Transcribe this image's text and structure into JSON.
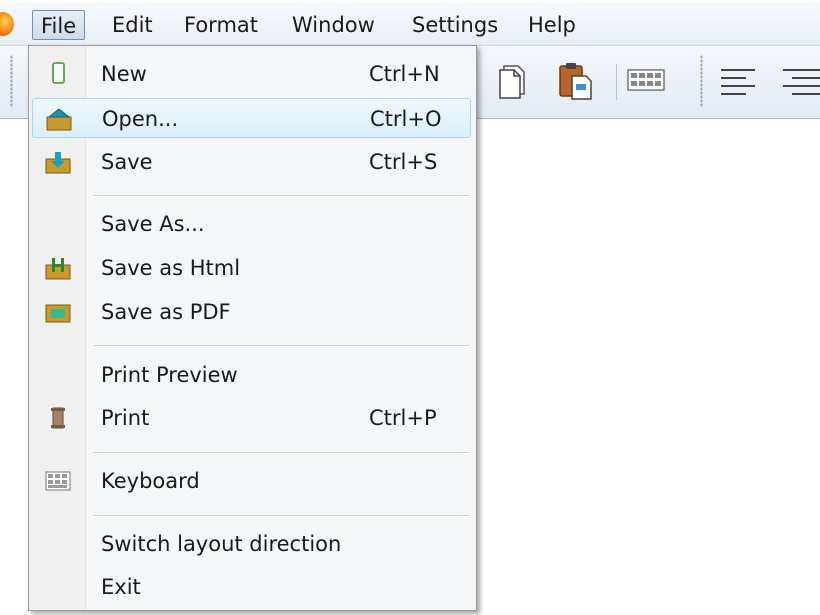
{
  "menubar": {
    "items": [
      {
        "label": "File"
      },
      {
        "label": "Edit"
      },
      {
        "label": "Format"
      },
      {
        "label": "Window"
      },
      {
        "label": "Settings"
      },
      {
        "label": "Help"
      }
    ]
  },
  "file_menu": {
    "items": [
      {
        "label": "New",
        "shortcut": "Ctrl+N",
        "icon": "new-document-icon"
      },
      {
        "label": "Open...",
        "shortcut": "Ctrl+O",
        "icon": "open-folder-icon",
        "highlighted": true
      },
      {
        "label": "Save",
        "shortcut": "Ctrl+S",
        "icon": "save-icon"
      },
      {
        "label": "Save As..."
      },
      {
        "label": "Save as Html",
        "icon": "save-html-icon"
      },
      {
        "label": "Save as PDF",
        "icon": "save-pdf-icon"
      },
      {
        "label": "Print Preview"
      },
      {
        "label": "Print",
        "shortcut": "Ctrl+P",
        "icon": "print-icon"
      },
      {
        "label": "Keyboard",
        "icon": "keyboard-icon"
      },
      {
        "label": "Switch layout direction"
      },
      {
        "label": "Exit"
      }
    ]
  },
  "toolbar": {
    "icons": [
      "copy-icon",
      "paste-icon",
      "keyboard-icon",
      "align-left-icon",
      "align-right-icon"
    ]
  },
  "colors": {
    "menu_highlight": "#d9f0fa",
    "menu_highlight_border": "#a8d8eb",
    "accent_orange": "#f07a1a"
  }
}
